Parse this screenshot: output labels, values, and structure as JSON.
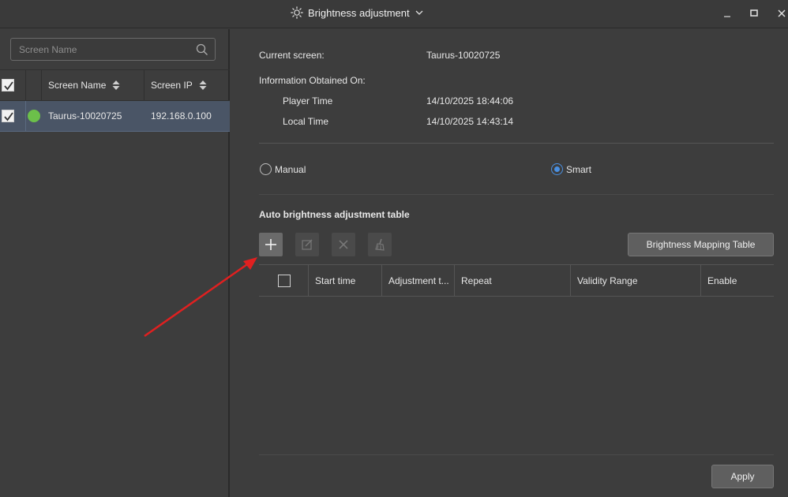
{
  "window": {
    "title": "Brightness adjustment",
    "minimize_glyph": "—",
    "maximize_glyph": "☐",
    "close_glyph": "✕"
  },
  "left_panel": {
    "search_placeholder": "Screen Name",
    "columns": [
      "Screen Name",
      "Screen IP"
    ],
    "rows": [
      {
        "name": "Taurus-10020725",
        "ip": "192.168.0.100",
        "status_color": "#6cc04a",
        "checked": true
      }
    ]
  },
  "info": {
    "current_screen_label": "Current screen:",
    "current_screen_value": "Taurus-10020725",
    "obtained_label": "Information Obtained On:",
    "player_time_label": "Player Time",
    "player_time_value": "14/10/2025 18:44:06",
    "local_time_label": "Local Time",
    "local_time_value": "14/10/2025 14:43:14"
  },
  "mode": {
    "manual_label": "Manual",
    "smart_label": "Smart",
    "selected": "Smart"
  },
  "auto_table": {
    "title": "Auto brightness adjustment table",
    "mapping_button": "Brightness Mapping Table",
    "columns": [
      "Start time",
      "Adjustment t...",
      "Repeat",
      "Validity Range",
      "Enable"
    ],
    "rows": []
  },
  "footer": {
    "apply_label": "Apply"
  },
  "colors": {
    "accent": "#4a90e2",
    "online": "#6cc04a",
    "annotation_arrow": "#e02020"
  }
}
